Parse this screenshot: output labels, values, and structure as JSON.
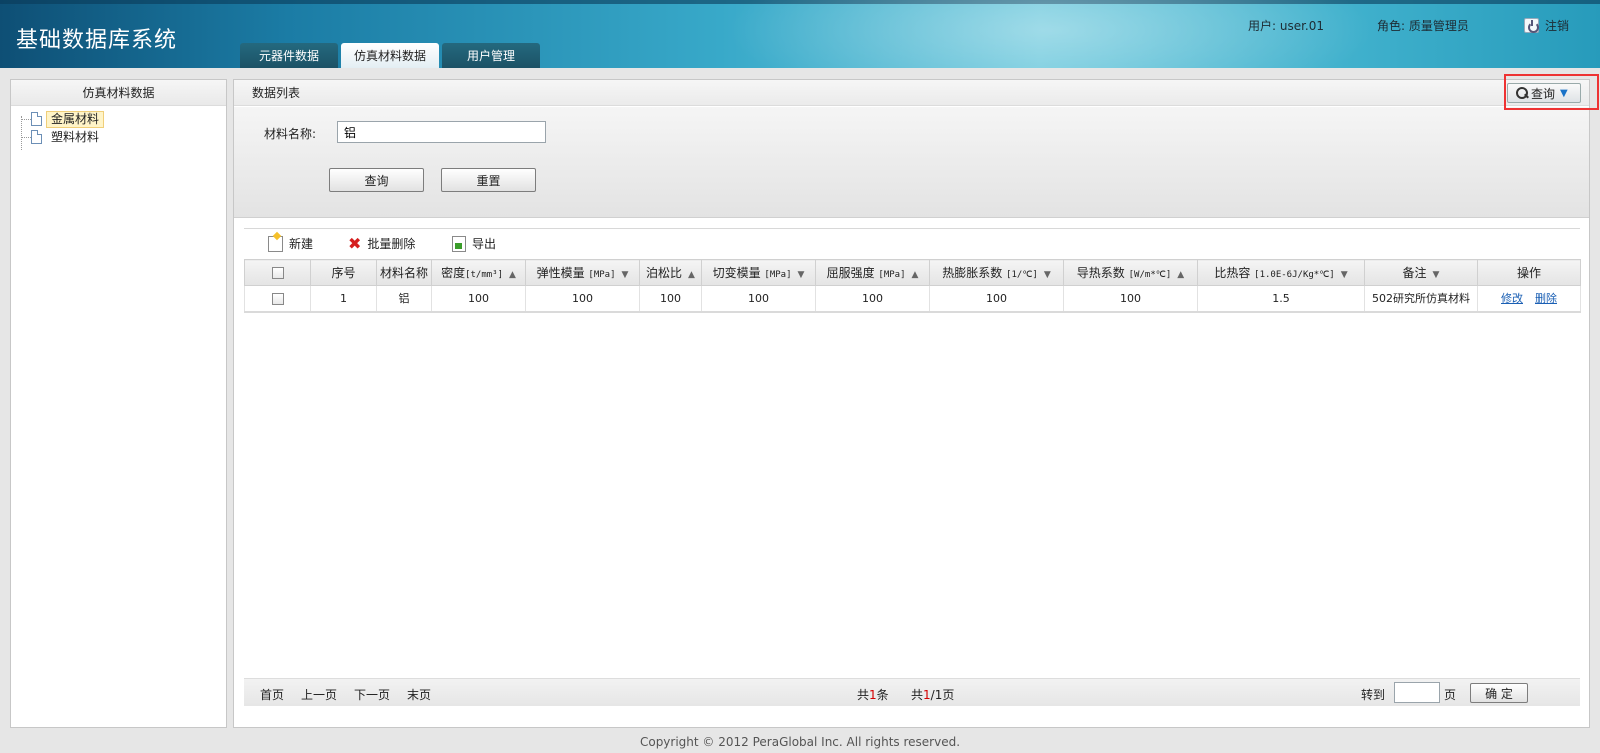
{
  "header": {
    "app_title": "基础数据库系统",
    "tabs": [
      {
        "label": "元器件数据",
        "active": false
      },
      {
        "label": "仿真材料数据",
        "active": true
      },
      {
        "label": "用户管理",
        "active": false
      }
    ],
    "user_text": "用户: user.01",
    "role_text": "角色: 质量管理员",
    "logout_label": "注销"
  },
  "sidebar": {
    "title": "仿真材料数据",
    "items": [
      {
        "label": "金属材料",
        "selected": true,
        "icon": "file-icon"
      },
      {
        "label": "塑料材料",
        "selected": false,
        "icon": "file-icon"
      }
    ]
  },
  "main": {
    "title": "数据列表",
    "query_toggle_label": "查询",
    "search": {
      "field_label": "材料名称:",
      "field_value": "铝",
      "search_button": "查询",
      "reset_button": "重置"
    },
    "toolbar": {
      "new_label": "新建",
      "batch_delete_label": "批量删除",
      "export_label": "导出"
    },
    "table": {
      "columns": [
        {
          "label": "",
          "unit": "",
          "sort": ""
        },
        {
          "label": "序号",
          "unit": "",
          "sort": ""
        },
        {
          "label": "材料名称",
          "unit": "",
          "sort": ""
        },
        {
          "label": "密度",
          "unit": "[t/mm³]",
          "sort": "▲"
        },
        {
          "label": "弹性模量",
          "unit": "[MPa]",
          "sort": "▼"
        },
        {
          "label": "泊松比",
          "unit": "",
          "sort": "▲"
        },
        {
          "label": "切变模量",
          "unit": "[MPa]",
          "sort": "▼"
        },
        {
          "label": "屈服强度",
          "unit": "[MPa]",
          "sort": "▲"
        },
        {
          "label": "热膨胀系数",
          "unit": "[1/℃]",
          "sort": "▼"
        },
        {
          "label": "导热系数",
          "unit": "[W/m*℃]",
          "sort": "▲"
        },
        {
          "label": "比热容",
          "unit": "[1.0E-6J/Kg*℃]",
          "sort": "▼"
        },
        {
          "label": "备注",
          "unit": "",
          "sort": "▼"
        },
        {
          "label": "操作",
          "unit": "",
          "sort": ""
        }
      ],
      "rows": [
        {
          "index": "1",
          "name": "铝",
          "density": "100",
          "elastic_modulus": "100",
          "poisson_ratio": "100",
          "shear_modulus": "100",
          "yield_strength": "100",
          "thermal_expansion": "100",
          "thermal_conductivity": "100",
          "specific_heat": "1.5",
          "remark": "502研究所仿真材料",
          "edit_label": "修改",
          "delete_label": "删除"
        }
      ]
    },
    "pager": {
      "first": "首页",
      "prev": "上一页",
      "next": "下一页",
      "last": "末页",
      "total_prefix": "共",
      "total_count": "1",
      "total_suffix": "条",
      "page_prefix": "共",
      "page_current": "1",
      "page_sep": "/1页",
      "goto_label": "转到",
      "goto_value": "",
      "page_unit": "页",
      "confirm_label": "确 定"
    }
  },
  "footer": {
    "copyright": "Copyright © 2012 PeraGlobal Inc. All rights reserved."
  },
  "colors": {
    "header_dark": "#0e4f75",
    "header_light": "#6cc8dc",
    "highlight": "#e33333",
    "link": "#1a5fb4"
  }
}
